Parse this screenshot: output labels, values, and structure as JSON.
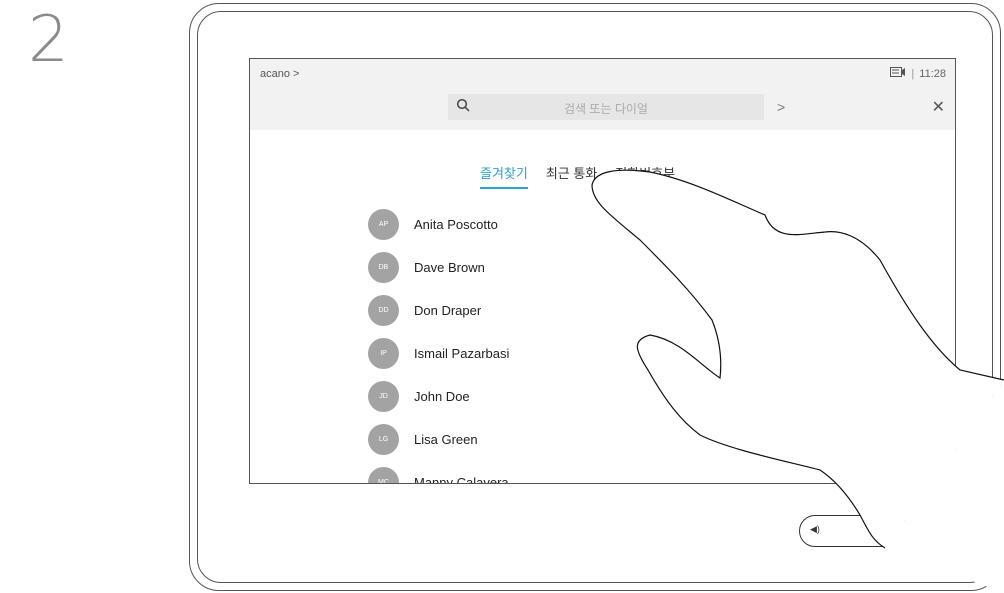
{
  "step_number": "2",
  "header": {
    "breadcrumb": "acano >",
    "time": "11:28",
    "separator": "|"
  },
  "search": {
    "placeholder": "검색 또는 다이얼"
  },
  "tabs": [
    {
      "label": "즐겨찾기",
      "active": true
    },
    {
      "label": "최근 통화",
      "active": false
    },
    {
      "label": "전화번호부",
      "active": false
    }
  ],
  "contacts": [
    {
      "initials": "AP",
      "name": "Anita Poscotto"
    },
    {
      "initials": "DB",
      "name": "Dave Brown"
    },
    {
      "initials": "DD",
      "name": "Don Draper"
    },
    {
      "initials": "IP",
      "name": "Ismail Pazarbasi"
    },
    {
      "initials": "JD",
      "name": "John Doe"
    },
    {
      "initials": "LG",
      "name": "Lisa Green"
    },
    {
      "initials": "MC",
      "name": "Manny Calavera"
    }
  ],
  "icons": {
    "search": "search-icon",
    "next": "chevron-right-icon",
    "close": "close-icon",
    "camera": "camera-icon",
    "volume": "speaker-icon",
    "mute": "microphone-muted-icon"
  },
  "colors": {
    "accent": "#2aa3c9",
    "avatar": "#a3a3a3",
    "topbar": "#f2f2f2"
  }
}
